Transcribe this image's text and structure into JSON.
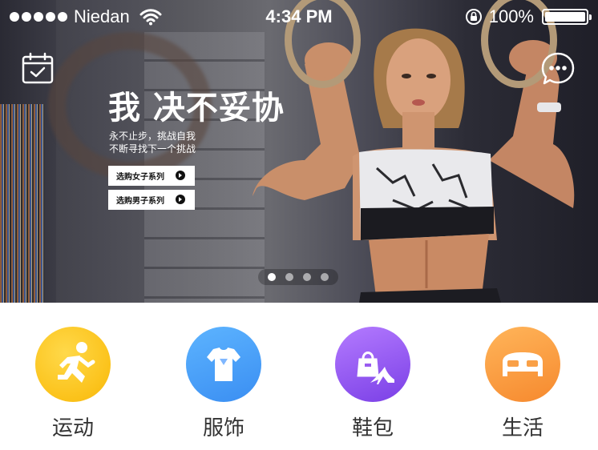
{
  "status_bar": {
    "carrier": "Niedan",
    "time": "4:34 PM",
    "battery_percent": "100%",
    "battery_level": 1.0
  },
  "hero": {
    "headline": "我 决不妥协",
    "tagline_line1": "永不止步，挑战自我",
    "tagline_line2": "不断寻找下一个挑战",
    "shop_women_label": "选购女子系列",
    "shop_men_label": "选购男子系列",
    "pager": {
      "count": 4,
      "active_index": 0
    }
  },
  "icons": {
    "calendar": "calendar-check-icon",
    "message": "message-more-icon",
    "wifi": "wifi-icon",
    "lock": "rotation-lock-icon",
    "battery": "battery-icon"
  },
  "categories": [
    {
      "label": "运动",
      "icon": "running-person-icon",
      "color": "#fbc21a"
    },
    {
      "label": "服饰",
      "icon": "tshirt-icon",
      "color": "#3a8ef2"
    },
    {
      "label": "鞋包",
      "icon": "handbag-heel-icon",
      "color": "#7a3fe6"
    },
    {
      "label": "生活",
      "icon": "bed-icon",
      "color": "#f6892e"
    }
  ]
}
